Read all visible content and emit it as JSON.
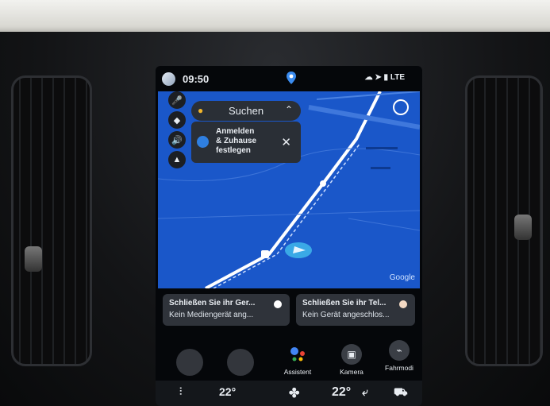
{
  "status_bar": {
    "time": "09:50",
    "indicators": "LTE"
  },
  "map": {
    "search_label": "Suchen",
    "login_card": {
      "line1": "Anmelden",
      "line2": "& Zuhause",
      "line3": "festlegen"
    },
    "attribution": "Google",
    "zoom_in": "+",
    "zoom_out": "–",
    "left_rail_icons": [
      "microphone-icon",
      "layers-icon",
      "volume-icon",
      "compass-icon"
    ]
  },
  "widgets": [
    {
      "title": "Schließen Sie ihr Ger...",
      "subtitle": "Kein Mediengerät ang...",
      "dot_color": "#ffffff"
    },
    {
      "title": "Schließen Sie ihr Tel...",
      "subtitle": "Kein Gerät angeschlos...",
      "dot_color": "#f3d9c3"
    }
  ],
  "apps": [
    {
      "label": "Assistent",
      "icon": "google-assistant-icon"
    },
    {
      "label": "Kamera",
      "icon": "camera-icon"
    },
    {
      "label": "Fahrmodi",
      "icon": "car-mode-icon"
    }
  ],
  "climate": {
    "left_temp": "22°",
    "right_temp": "22°",
    "fan": "fan-icon",
    "seat": "seat-icon"
  },
  "colors": {
    "map_blue": "#1a57c9",
    "road": "#ffffff",
    "panel": "#2f333a"
  }
}
